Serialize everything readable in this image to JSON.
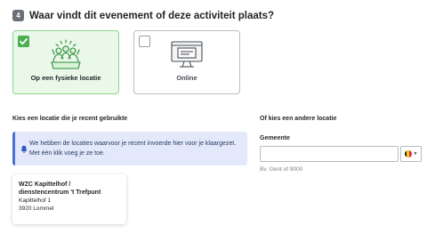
{
  "step": {
    "number": "4",
    "title": "Waar vindt dit evenement of deze activiteit plaats?"
  },
  "choices": [
    {
      "label": "Op een fysieke locatie",
      "selected": true,
      "icon": "people-group-icon"
    },
    {
      "label": "Online",
      "selected": false,
      "icon": "monitor-icon"
    }
  ],
  "recent": {
    "heading": "Kies een locatie die je recent gebruikte",
    "info_text_line1": "We hebben de locaties waarvoor je recent invoerde hier voor je klaargezet.",
    "info_text_line2": "Met één klik voeg je ze toe.",
    "locations": [
      {
        "name_line1": "WZC Kapittelhof /",
        "name_line2": "dienstencentrum 't Trefpunt",
        "street": "Kapittelhof 1",
        "city": "3920 Lommel"
      }
    ]
  },
  "other": {
    "heading": "Of kies een andere locatie",
    "gemeente_label": "Gemeente",
    "gemeente_value": "",
    "hint": "Bv. Gent of 9000",
    "country_flag": "belgium-flag-icon"
  },
  "colors": {
    "selected_bg": "#eaf8ea",
    "selected_border": "#8bd58b",
    "check": "#4caf50",
    "info_bg": "#e3e9fb",
    "info_accent": "#4a6fd4"
  }
}
